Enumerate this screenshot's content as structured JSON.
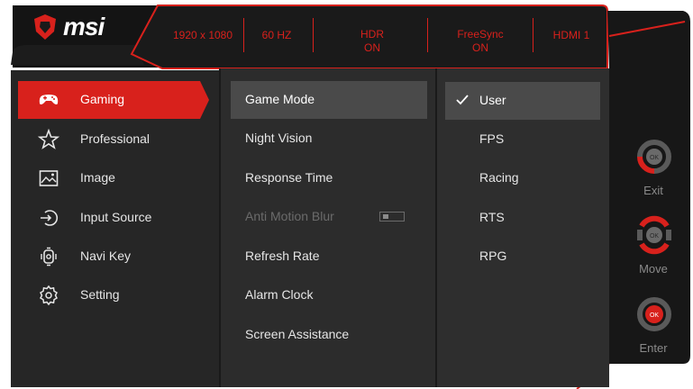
{
  "brand": {
    "name": "msi"
  },
  "status_bar": [
    {
      "label": "1920 x 1080"
    },
    {
      "label": "60 HZ"
    },
    {
      "label": "HDR",
      "value": "ON"
    },
    {
      "label": "FreeSync",
      "value": "ON"
    },
    {
      "label": "HDMI 1"
    }
  ],
  "main_menu": [
    {
      "label": "Gaming",
      "icon": "gamepad-icon",
      "selected": true
    },
    {
      "label": "Professional",
      "icon": "star-icon"
    },
    {
      "label": "Image",
      "icon": "image-icon"
    },
    {
      "label": "Input Source",
      "icon": "input-source-icon"
    },
    {
      "label": "Navi Key",
      "icon": "navi-key-icon"
    },
    {
      "label": "Setting",
      "icon": "gear-icon"
    }
  ],
  "sub_menu": [
    {
      "label": "Game Mode",
      "highlighted": true
    },
    {
      "label": "Night Vision"
    },
    {
      "label": "Response Time"
    },
    {
      "label": "Anti Motion Blur",
      "disabled": true,
      "toggle": "off"
    },
    {
      "label": "Refresh Rate"
    },
    {
      "label": "Alarm Clock"
    },
    {
      "label": "Screen Assistance"
    }
  ],
  "options": [
    {
      "label": "User",
      "checked": true
    },
    {
      "label": "FPS"
    },
    {
      "label": "Racing"
    },
    {
      "label": "RTS"
    },
    {
      "label": "RPG"
    }
  ],
  "nav_keys": [
    {
      "label": "Exit",
      "icon": "exit-key-icon"
    },
    {
      "label": "Move",
      "icon": "move-key-icon"
    },
    {
      "label": "Enter",
      "icon": "enter-key-icon"
    }
  ],
  "colors": {
    "accent": "#d8211c",
    "background": "#1b1b1b",
    "panel": "#2c2c2c",
    "highlight": "#4a4a4a"
  }
}
